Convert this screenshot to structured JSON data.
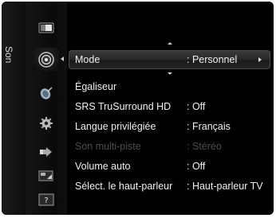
{
  "osd": {
    "title": "Son",
    "categories": [
      {
        "icon": "picture-icon",
        "selected": false
      },
      {
        "icon": "sound-speaker-icon",
        "selected": true
      },
      {
        "icon": "channel-satellite-icon",
        "selected": false
      },
      {
        "icon": "setup-gear-icon",
        "selected": false
      },
      {
        "icon": "input-icon",
        "selected": false
      },
      {
        "icon": "application-icon",
        "selected": false
      },
      {
        "icon": "support-question-icon",
        "selected": false
      }
    ],
    "menu": {
      "items": [
        {
          "label": "Mode",
          "value": ": Personnel",
          "selected": true,
          "disabled": false
        },
        {
          "label": "Égaliseur",
          "value": "",
          "selected": false,
          "disabled": false
        },
        {
          "label": "SRS TruSurround HD",
          "value": ": Off",
          "selected": false,
          "disabled": false
        },
        {
          "label": "Langue privilégiée",
          "value": ": Français",
          "selected": false,
          "disabled": false
        },
        {
          "label": "Son multi-piste",
          "value": ": Stéréo",
          "selected": false,
          "disabled": true
        },
        {
          "label": "Volume auto",
          "value": ": Off",
          "selected": false,
          "disabled": false
        },
        {
          "label": "Sélect. le haut-parleur",
          "value": ": Haut-parleur TV",
          "selected": false,
          "disabled": false
        }
      ]
    }
  },
  "colors": {
    "background": "#000000",
    "text": "#f2f2f2",
    "disabled_text": "#4d4d4d",
    "highlight": "#2e2e2e"
  }
}
